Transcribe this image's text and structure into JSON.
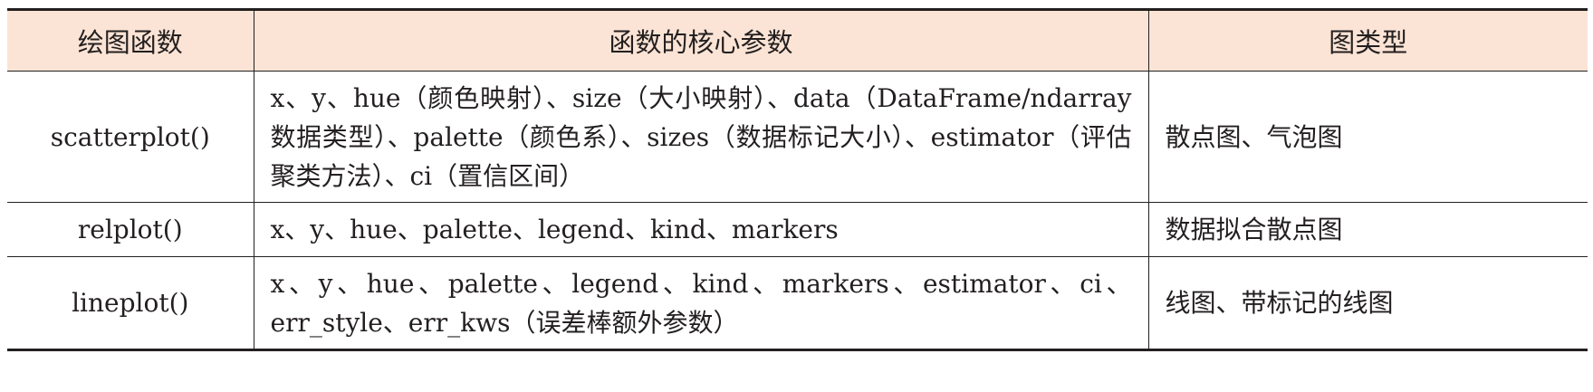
{
  "table": {
    "headers": [
      "绘图函数",
      "函数的核心参数",
      "图类型"
    ],
    "rows": [
      {
        "function": "scatterplot()",
        "params": "x、y、hue（颜色映射）、size（大小映射）、data（DataFrame/ndarray 数据类型）、palette（颜色系）、sizes（数据标记大小）、estimator（评估聚类方法）、ci（置信区间）",
        "chart_type": "散点图、气泡图"
      },
      {
        "function": "relplot()",
        "params": "x、y、hue、palette、legend、kind、markers",
        "chart_type": "数据拟合散点图"
      },
      {
        "function": "lineplot()",
        "params": "x、y、hue、palette、legend、kind、markers、estimator、ci、err_style、err_kws（误差棒额外参数）",
        "chart_type": "线图、带标记的线图"
      }
    ]
  }
}
